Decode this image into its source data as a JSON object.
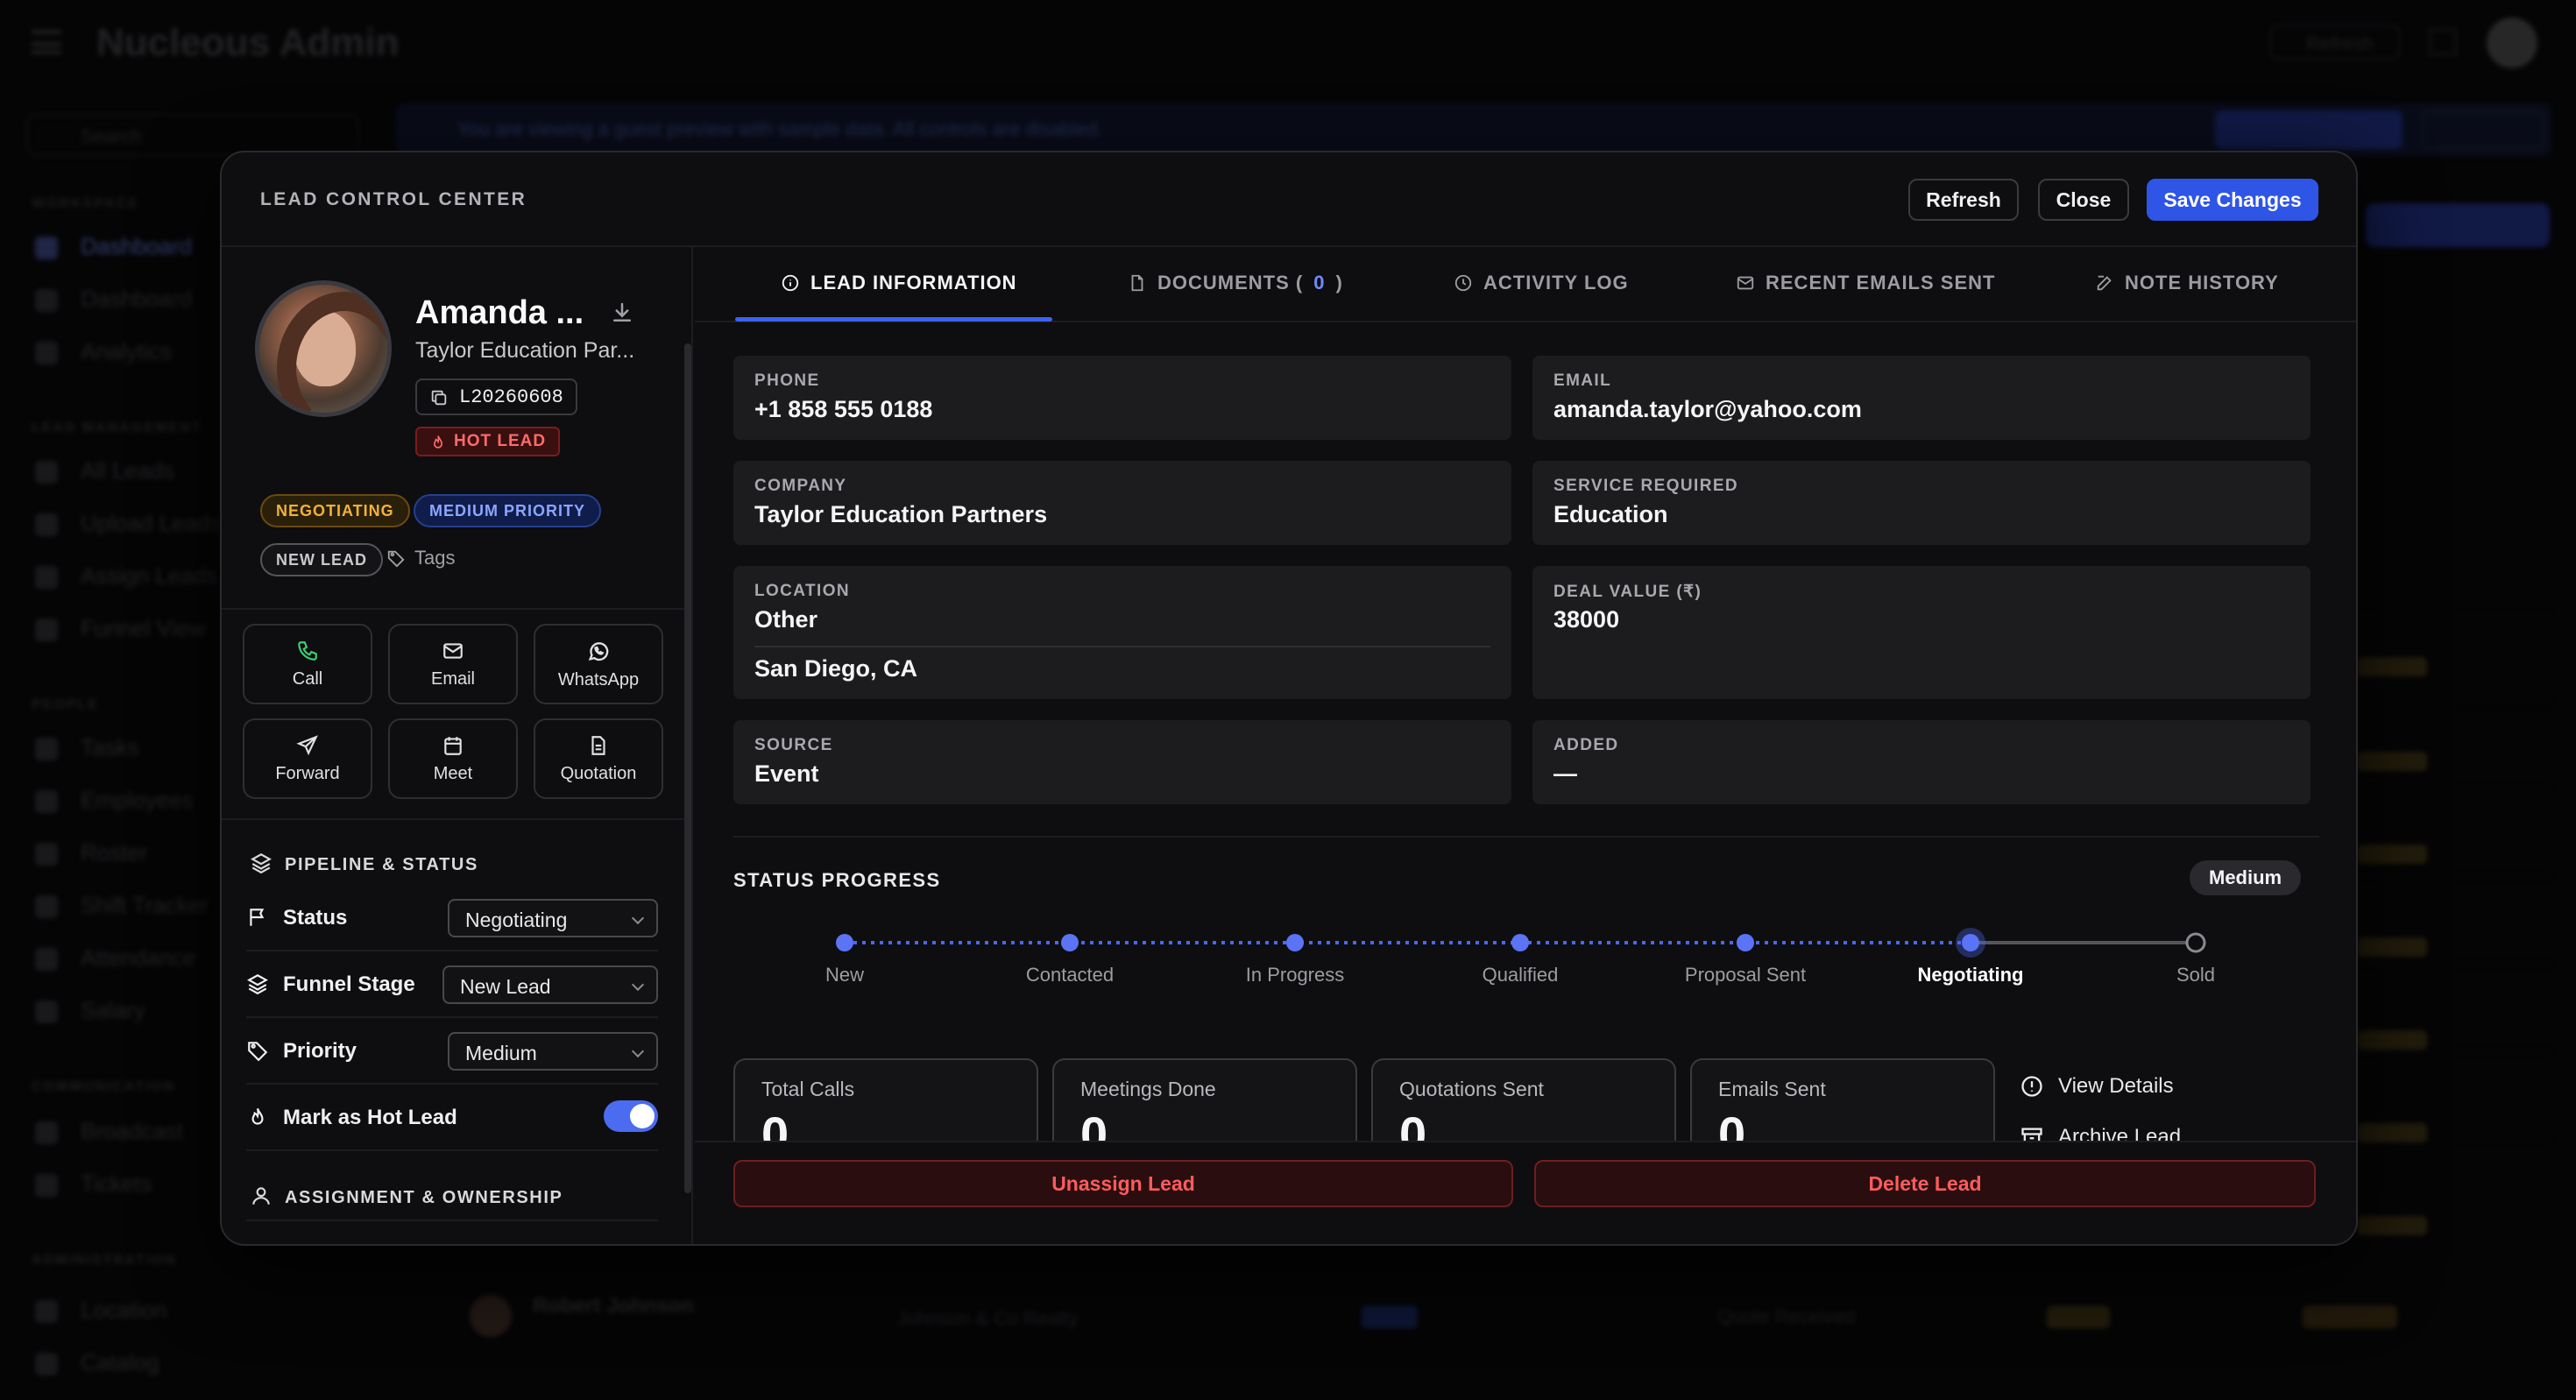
{
  "background_app": {
    "title": "Nucleous Admin",
    "search_placeholder": "Search",
    "refresh_label": "Refresh",
    "banner_text": "You are viewing a guest preview with sample data. All controls are disabled.",
    "sidebar_sections": [
      "WORKSPACE",
      "LEAD MANAGEMENT",
      "PEOPLE",
      "COMMUNICATION",
      "ADMINISTRATION"
    ],
    "sidebar_items": [
      "Dashboard",
      "Dashboard",
      "Analytics",
      "All Leads",
      "Upload Leads",
      "Assign Leads",
      "Funnel View",
      "Tasks",
      "Employees",
      "Roster",
      "Shift Tracker",
      "Attendance",
      "Salary",
      "Broadcast",
      "Tickets",
      "Location",
      "Catalog"
    ],
    "row_name": "Robert Johnson",
    "row_company": "Johnson & Co Realty",
    "row_status": "Quote Received"
  },
  "modal": {
    "title": "LEAD CONTROL CENTER",
    "buttons": {
      "refresh": "Refresh",
      "close": "Close",
      "save": "Save Changes"
    },
    "lead": {
      "name": "Amanda ...",
      "company": "Taylor Education Par...",
      "id": "L20260608",
      "hot_badge": "HOT LEAD",
      "tags": {
        "status": "NEGOTIATING",
        "priority": "MEDIUM PRIORITY",
        "new": "NEW LEAD"
      },
      "tags_link": "Tags"
    },
    "actions": [
      "Call",
      "Email",
      "WhatsApp",
      "Forward",
      "Meet",
      "Quotation"
    ],
    "pipeline": {
      "title": "PIPELINE & STATUS",
      "status_label": "Status",
      "status_value": "Negotiating",
      "funnel_label": "Funnel Stage",
      "funnel_value": "New Lead",
      "priority_label": "Priority",
      "priority_value": "Medium",
      "hot_label": "Mark as Hot Lead",
      "hot_on": true
    },
    "assignment_title": "ASSIGNMENT & OWNERSHIP",
    "tabs": {
      "info": "LEAD INFORMATION",
      "docs_prefix": "DOCUMENTS (",
      "docs_count": "0",
      "docs_suffix": ")",
      "activity": "ACTIVITY LOG",
      "emails": "RECENT EMAILS SENT",
      "notes": "NOTE HISTORY"
    },
    "info": {
      "phone_label": "PHONE",
      "phone": "+1 858 555 0188",
      "email_label": "EMAIL",
      "email": "amanda.taylor@yahoo.com",
      "company_label": "COMPANY",
      "company": "Taylor Education Partners",
      "service_label": "SERVICE REQUIRED",
      "service": "Education",
      "location_label": "LOCATION",
      "location": "Other",
      "location_city": "San Diego, CA",
      "deal_label": "DEAL VALUE (₹)",
      "deal": "38000",
      "source_label": "SOURCE",
      "source": "Event",
      "added_label": "ADDED",
      "added": "—"
    },
    "status_progress": {
      "title": "STATUS PROGRESS",
      "priority_pill": "Medium",
      "stages": [
        "New",
        "Contacted",
        "In Progress",
        "Qualified",
        "Proposal Sent",
        "Negotiating",
        "Sold"
      ],
      "current_index": 5
    },
    "stats": {
      "calls_label": "Total Calls",
      "calls": "0",
      "meetings_label": "Meetings Done",
      "meetings": "0",
      "quotes_label": "Quotations Sent",
      "quotes": "0",
      "emails_label": "Emails Sent",
      "emails": "0"
    },
    "side_links": {
      "view": "View Details",
      "archive": "Archive Lead"
    },
    "footer": {
      "unassign": "Unassign Lead",
      "delete": "Delete Lead"
    }
  },
  "colors": {
    "accent": "#3b62f0",
    "danger": "#ff5c5c",
    "hot": "#ff6b6b",
    "warning": "#f0b23a"
  }
}
